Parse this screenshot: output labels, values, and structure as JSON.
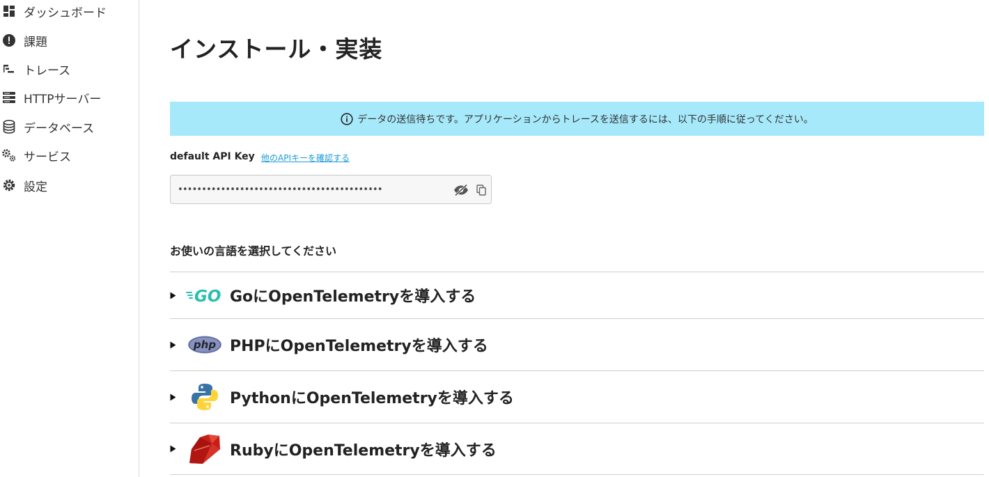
{
  "sidebar": {
    "items": [
      {
        "label": "ダッシュボード",
        "icon": "dashboard-icon"
      },
      {
        "label": "課題",
        "icon": "alert-icon"
      },
      {
        "label": "トレース",
        "icon": "trace-icon"
      },
      {
        "label": "HTTPサーバー",
        "icon": "server-icon"
      },
      {
        "label": "データベース",
        "icon": "database-icon"
      },
      {
        "label": "サービス",
        "icon": "cogs-icon"
      },
      {
        "label": "設定",
        "icon": "gear-icon"
      }
    ]
  },
  "main": {
    "title": "インストール・実装",
    "banner": "データの送信待ちです。アプリケーションからトレースを送信するには、以下の手順に従ってください。",
    "api_key": {
      "label": "default API Key",
      "link": "他のAPIキーを確認する",
      "value": "•••••••••••••••••••••••••••••••••••••••••••"
    },
    "language_heading": "お使いの言語を選択してください",
    "languages": [
      {
        "title": "GoにOpenTelemetryを導入する",
        "logo": "go-logo"
      },
      {
        "title": "PHPにOpenTelemetryを導入する",
        "logo": "php-logo"
      },
      {
        "title": "PythonにOpenTelemetryを導入する",
        "logo": "python-logo"
      },
      {
        "title": "RubyにOpenTelemetryを導入する",
        "logo": "ruby-logo"
      }
    ]
  },
  "colors": {
    "banner_bg": "#a6e9fa",
    "link": "#1a9ad6",
    "go": "#29beb0",
    "php": "#8892be",
    "python_blue": "#3873a6",
    "python_yellow": "#ffd43b",
    "ruby": "#c91e16"
  }
}
